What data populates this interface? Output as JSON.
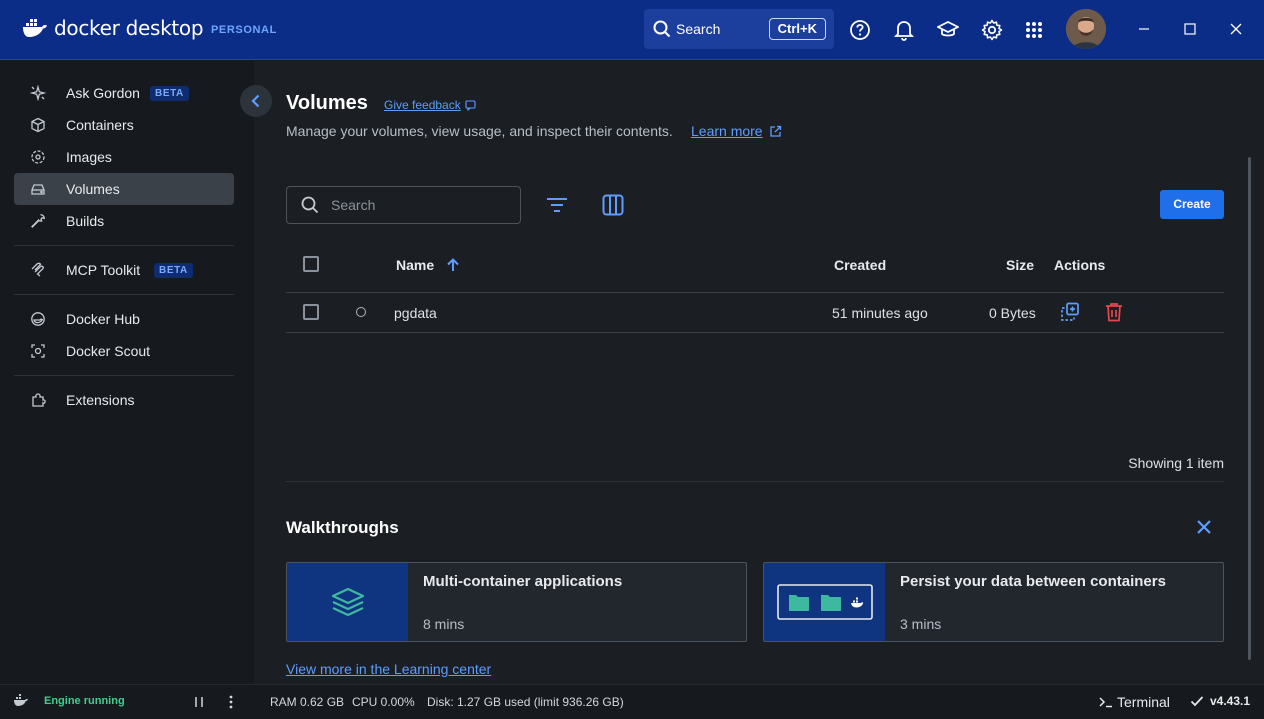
{
  "app": {
    "logo_text": "docker desktop",
    "plan_badge": "PERSONAL",
    "search_label": "Search",
    "search_shortcut": "Ctrl+K"
  },
  "sidebar": {
    "items": [
      {
        "label": "Ask Gordon",
        "badge": "BETA",
        "icon": "sparkles-icon"
      },
      {
        "label": "Containers",
        "icon": "container-icon"
      },
      {
        "label": "Images",
        "icon": "image-icon"
      },
      {
        "label": "Volumes",
        "icon": "volume-icon",
        "active": true
      },
      {
        "label": "Builds",
        "icon": "wrench-icon"
      },
      {
        "label": "MCP Toolkit",
        "badge": "BETA",
        "icon": "mcp-icon"
      },
      {
        "label": "Docker Hub",
        "icon": "hub-icon"
      },
      {
        "label": "Docker Scout",
        "icon": "scout-icon"
      },
      {
        "label": "Extensions",
        "icon": "puzzle-icon"
      }
    ]
  },
  "main": {
    "title": "Volumes",
    "feedback_label": "Give feedback",
    "subtitle": "Manage your volumes, view usage, and inspect their contents.",
    "learn_more": "Learn more",
    "search_placeholder": "Search",
    "create_label": "Create",
    "table": {
      "headers": {
        "name": "Name",
        "created": "Created",
        "size": "Size",
        "actions": "Actions"
      },
      "rows": [
        {
          "name": "pgdata",
          "created": "51 minutes ago",
          "size": "0 Bytes"
        }
      ]
    },
    "showing": "Showing 1 item"
  },
  "walkthroughs": {
    "title": "Walkthroughs",
    "cards": [
      {
        "title": "Multi-container applications",
        "duration": "8 mins"
      },
      {
        "title": "Persist your data between containers",
        "duration": "3 mins"
      }
    ],
    "learning_link": "View more in the Learning center"
  },
  "statusbar": {
    "engine": "Engine running",
    "ram": "RAM 0.62 GB",
    "cpu": "CPU 0.00%",
    "disk": "Disk: 1.27 GB used (limit 936.26 GB)",
    "terminal": "Terminal",
    "version": "v4.43.1"
  },
  "colors": {
    "titlebar": "#0b2c87",
    "accent": "#1f6feb",
    "link": "#5f9cff",
    "engine_ok": "#3ecf8e",
    "delete": "#e5484d"
  }
}
